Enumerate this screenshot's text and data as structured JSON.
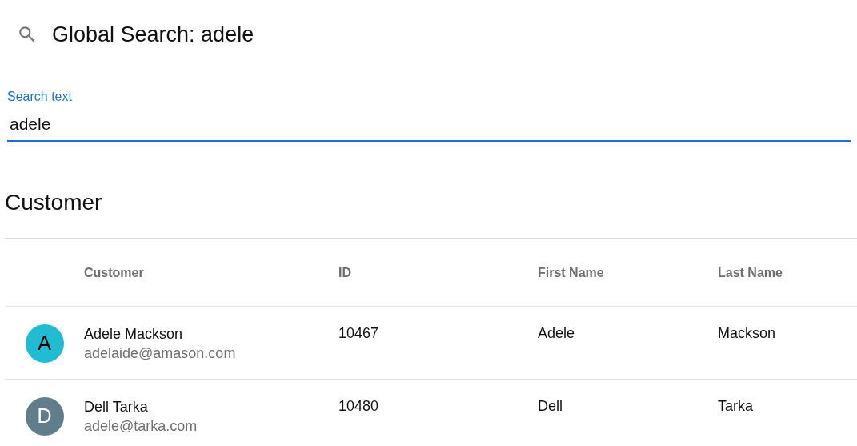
{
  "header": {
    "title": "Global Search: adele"
  },
  "search_field": {
    "label": "Search text",
    "value": "adele"
  },
  "section": {
    "title": "Customer"
  },
  "table": {
    "columns": [
      "Customer",
      "ID",
      "First Name",
      "Last Name"
    ],
    "rows": [
      {
        "initial": "A",
        "color": "#1fbcd2",
        "name": "Adele Mackson",
        "email": "adelaide@amason.com",
        "id": "10467",
        "first_name": "Adele",
        "last_name": "Mackson"
      },
      {
        "initial": "D",
        "color": "#607d8b",
        "name": "Dell Tarka",
        "email": "adele@tarka.com",
        "id": "10480",
        "first_name": "Dell",
        "last_name": "Tarka"
      }
    ]
  }
}
